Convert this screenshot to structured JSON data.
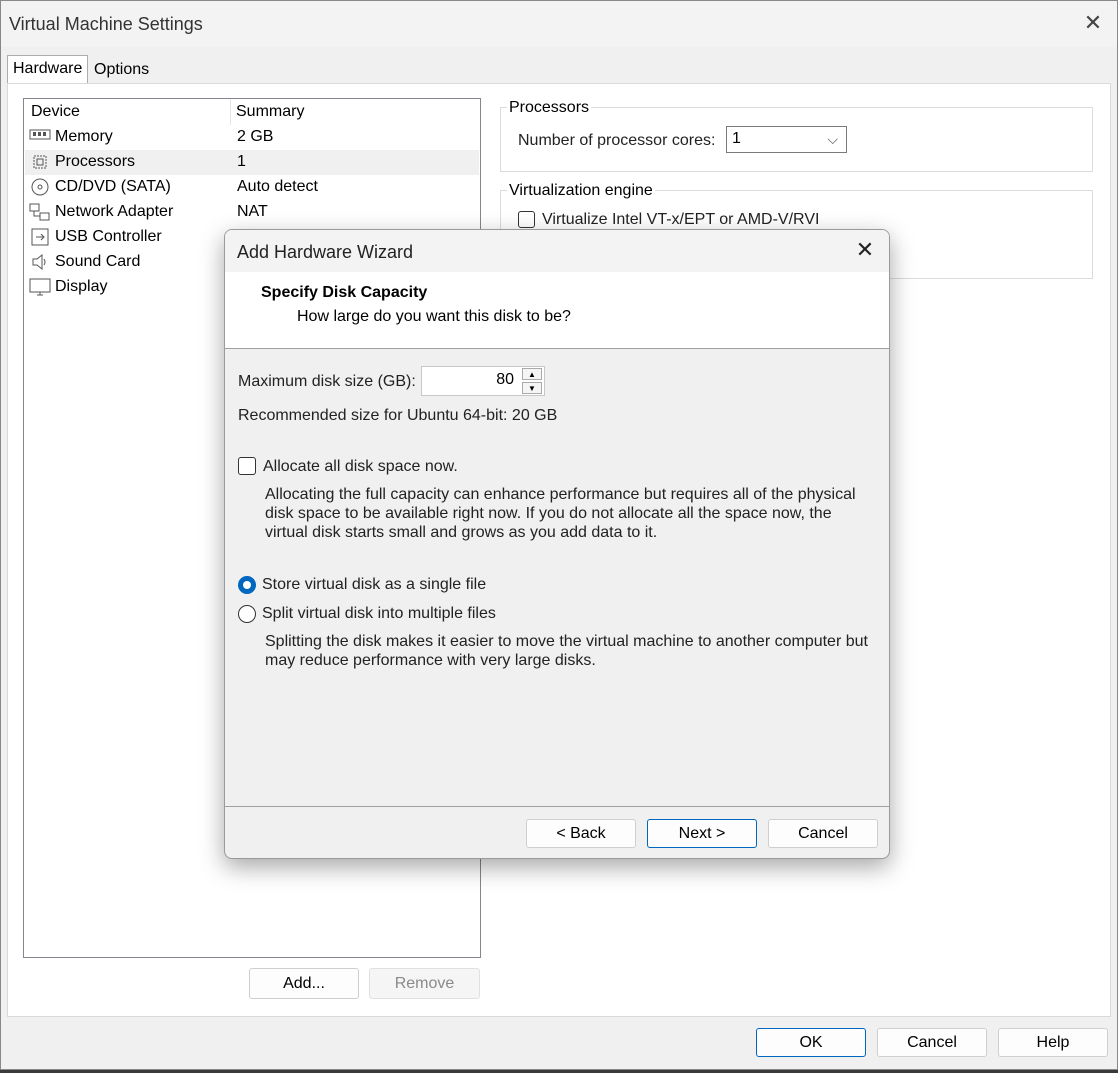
{
  "window": {
    "title": "Virtual Machine Settings"
  },
  "tabs": [
    {
      "label": "Hardware"
    },
    {
      "label": "Options"
    }
  ],
  "devices": {
    "headers": {
      "device": "Device",
      "summary": "Summary"
    },
    "rows": [
      {
        "name": "Memory",
        "summary": "2 GB",
        "icon": "memory-icon"
      },
      {
        "name": "Processors",
        "summary": "1",
        "icon": "processor-icon"
      },
      {
        "name": "CD/DVD (SATA)",
        "summary": "Auto detect",
        "icon": "disc-icon"
      },
      {
        "name": "Network Adapter",
        "summary": "NAT",
        "icon": "network-icon"
      },
      {
        "name": "USB Controller",
        "summary": "",
        "icon": "usb-icon"
      },
      {
        "name": "Sound Card",
        "summary": "",
        "icon": "speaker-icon"
      },
      {
        "name": "Display",
        "summary": "",
        "icon": "monitor-icon"
      }
    ],
    "add_label": "Add...",
    "remove_label": "Remove"
  },
  "processors": {
    "group_title": "Processors",
    "cores_label": "Number of processor cores:",
    "cores_value": "1"
  },
  "virtualization": {
    "group_title": "Virtualization engine",
    "vtx_label": "Virtualize Intel VT-x/EPT or AMD-V/RVI"
  },
  "footer": {
    "ok": "OK",
    "cancel": "Cancel",
    "help": "Help"
  },
  "wizard": {
    "title": "Add Hardware Wizard",
    "heading": "Specify Disk Capacity",
    "subheading": "How large do you want this disk to be?",
    "max_size_label": "Maximum disk size (GB):",
    "max_size_value": "80",
    "recommended": "Recommended size for Ubuntu 64-bit: 20 GB",
    "allocate_label": "Allocate all disk space now.",
    "allocate_desc": "Allocating the full capacity can enhance performance but requires all of the physical disk space to be available right now. If you do not allocate all the space now, the virtual disk starts small and grows as you add data to it.",
    "single_label": "Store virtual disk as a single file",
    "split_label": "Split virtual disk into multiple files",
    "split_desc": "Splitting the disk makes it easier to move the virtual machine to another computer but may reduce performance with very large disks.",
    "back": "< Back",
    "next": "Next >",
    "cancel": "Cancel"
  }
}
